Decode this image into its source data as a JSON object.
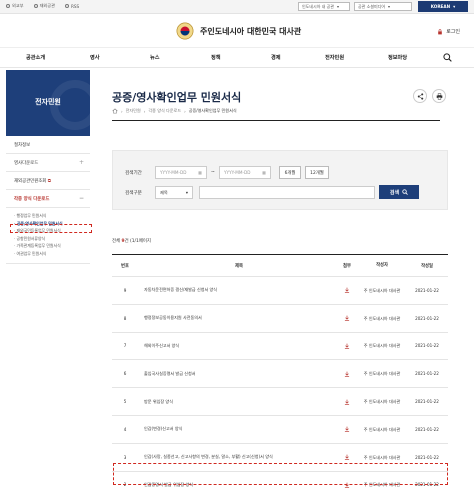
{
  "topbar": {
    "links": [
      "외교부",
      "재외공관",
      "RSS"
    ],
    "select1": "인도네시아 내 공관",
    "select2": "공관 소셜미디어",
    "lang": "KOREAN"
  },
  "header": {
    "title": "주인도네시아 대한민국 대사관",
    "login": "로그인"
  },
  "gnb": [
    "공관소개",
    "영사",
    "뉴스",
    "정책",
    "경제",
    "전자민원",
    "정보마당"
  ],
  "sidebar": {
    "hero_title": "전자민원",
    "menu": [
      "절차정보",
      "영사다운로드",
      "재외공관민원조회",
      "각종 양식 다운로드"
    ],
    "submenu": [
      "행정업무 민원서식",
      "공증/영사확인업무 민원서식",
      "재외국민등록업무 민원서식",
      "공항민원서류양식",
      "가족관계등록업무 민원서식",
      "여권업무 민원서식"
    ]
  },
  "content": {
    "title": "공증/영사확인업무 민원서식",
    "breadcrumb": [
      "전자민원",
      "각종 양식 다운로드",
      "공증/영사확인업무 민원서식"
    ]
  },
  "search": {
    "period_label": "검색기간",
    "date_placeholder": "YYYY-MM-DD",
    "tilde": "~",
    "btn_6m": "6개월",
    "btn_12m": "12개월",
    "type_label": "검색구분",
    "type_value": "제목",
    "search_btn": "검색"
  },
  "total": {
    "prefix": "전체",
    "count": "9",
    "suffix": "건 (1/1페이지"
  },
  "table": {
    "headers": [
      "번호",
      "제목",
      "첨부",
      "작성자",
      "작성일"
    ],
    "rows": [
      {
        "no": "9",
        "title": "자동차운전면허증 갱신/재발급 신청서 양식",
        "writer": "주 인도네시아 대사관",
        "date": "2021-01-22"
      },
      {
        "no": "8",
        "title": "행정정보공동이용지원 사전동의서",
        "writer": "주 인도네시아 대사관",
        "date": "2021-01-22"
      },
      {
        "no": "7",
        "title": "해외이주신고서 양식",
        "writer": "주 인도네시아 대사관",
        "date": "2021-01-22"
      },
      {
        "no": "6",
        "title": "출입국사실증명서 발급 신청서",
        "writer": "주 인도네시아 대사관",
        "date": "2021-01-22"
      },
      {
        "no": "5",
        "title": "방문 위임장 양식",
        "writer": "주 인도네시아 대사관",
        "date": "2021-01-22"
      },
      {
        "no": "4",
        "title": "인감(변경)신고서 양식",
        "writer": "주 인도네시아 대사관",
        "date": "2021-01-22"
      },
      {
        "no": "3",
        "title": "인감(사망, 실종선고, 신고사항의 변경, 분실, 말소, 부활) 신고(신청)서 양식",
        "writer": "주 인도네시아 대사관",
        "date": "2021-01-22"
      },
      {
        "no": "2",
        "title": "인감증명서 발급 위임장 양식",
        "writer": "주 인도네시아 대사관",
        "date": "2021-01-22"
      }
    ]
  },
  "colors": {
    "navy": "#1e3f7a",
    "accent_red": "#b7332d",
    "highlight": "#d0281f"
  }
}
